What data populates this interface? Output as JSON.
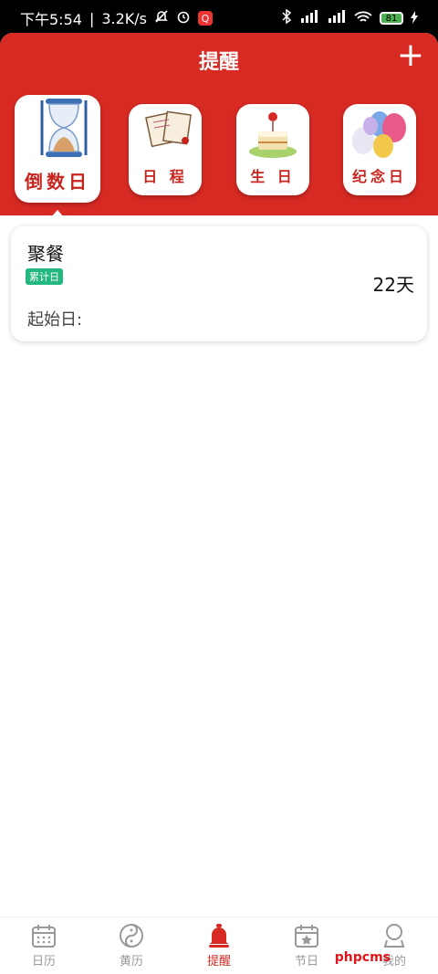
{
  "status": {
    "time": "下午5:54",
    "speed": "3.2K/s",
    "app_badge": "Q",
    "battery": "81",
    "sig1": "HD",
    "sig2": "HD"
  },
  "header": {
    "title": "提醒"
  },
  "categories": [
    {
      "label": "倒数日"
    },
    {
      "label": "日 程"
    },
    {
      "label": "生 日"
    },
    {
      "label": "纪念日"
    }
  ],
  "card": {
    "title": "聚餐",
    "tag": "累计日",
    "days": "22天",
    "start_label": "起始日:"
  },
  "nav": [
    {
      "label": "日历"
    },
    {
      "label": "黄历"
    },
    {
      "label": "提醒"
    },
    {
      "label": "节日"
    },
    {
      "label": "我的"
    }
  ],
  "watermark": "phpcms",
  "colors": {
    "primary": "#d62a23",
    "tag": "#23b880"
  }
}
